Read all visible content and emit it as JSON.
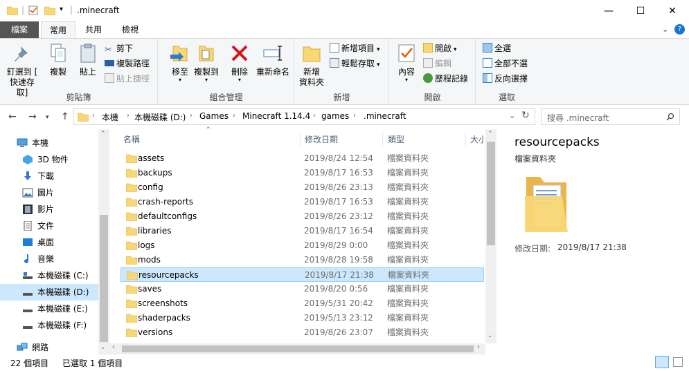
{
  "window": {
    "title": ".minecraft",
    "controls": {
      "minimize": "—",
      "maximize": "☐",
      "close": "✕"
    }
  },
  "ribbon": {
    "tabs": [
      "檔案",
      "常用",
      "共用",
      "檢視"
    ],
    "groups": {
      "clipboard": {
        "label": "剪貼簿",
        "pin": "釘選到 [\n快速存取]",
        "pin_l1": "釘選到 [",
        "pin_l2": "快速存取]",
        "copy": "複製",
        "paste": "貼上",
        "cut": "剪下",
        "copy_path": "複製路徑",
        "paste_shortcut": "貼上捷徑"
      },
      "organize": {
        "label": "組合管理",
        "move_to": "移至",
        "copy_to": "複製到",
        "delete": "刪除",
        "rename": "重新命名"
      },
      "new": {
        "label": "新增",
        "new_folder_l1": "新增",
        "new_folder_l2": "資料夾",
        "new_item": "新增項目",
        "easy_access": "輕鬆存取"
      },
      "open": {
        "label": "開啟",
        "properties": "內容",
        "open": "開啟",
        "edit": "編輯",
        "history": "歷程記錄"
      },
      "select": {
        "label": "選取",
        "select_all": "全選",
        "select_none": "全部不選",
        "invert": "反向選擇"
      }
    }
  },
  "address": {
    "crumbs": [
      "本機",
      "本機磁碟 (D:)",
      "Games",
      "Minecraft 1.14.4",
      "games",
      ".minecraft"
    ],
    "search_placeholder": "搜尋 .minecraft"
  },
  "sidebar": {
    "items": [
      {
        "label": "本機",
        "icon": "computer-icon"
      },
      {
        "label": "3D 物件",
        "icon": "3d-objects-icon"
      },
      {
        "label": "下載",
        "icon": "download-icon"
      },
      {
        "label": "圖片",
        "icon": "pictures-icon"
      },
      {
        "label": "影片",
        "icon": "videos-icon"
      },
      {
        "label": "文件",
        "icon": "documents-icon"
      },
      {
        "label": "桌面",
        "icon": "desktop-icon"
      },
      {
        "label": "音樂",
        "icon": "music-icon"
      },
      {
        "label": "本機磁碟 (C:)",
        "icon": "drive-icon"
      },
      {
        "label": "本機磁碟 (D:)",
        "icon": "drive-icon"
      },
      {
        "label": "本機磁碟 (E:)",
        "icon": "drive-icon"
      },
      {
        "label": "本機磁碟 (F:)",
        "icon": "drive-icon"
      },
      {
        "label": "網路",
        "icon": "network-icon"
      }
    ]
  },
  "filelist": {
    "columns": {
      "name": "名稱",
      "date": "修改日期",
      "type": "類型",
      "size": "大小"
    },
    "rows": [
      {
        "name": "assets",
        "date": "2019/8/24 12:54",
        "type": "檔案資料夾"
      },
      {
        "name": "backups",
        "date": "2019/8/17 16:53",
        "type": "檔案資料夾"
      },
      {
        "name": "config",
        "date": "2019/8/26 23:13",
        "type": "檔案資料夾"
      },
      {
        "name": "crash-reports",
        "date": "2019/8/17 16:53",
        "type": "檔案資料夾"
      },
      {
        "name": "defaultconfigs",
        "date": "2019/8/26 23:12",
        "type": "檔案資料夾"
      },
      {
        "name": "libraries",
        "date": "2019/8/17 16:54",
        "type": "檔案資料夾"
      },
      {
        "name": "logs",
        "date": "2019/8/29 0:00",
        "type": "檔案資料夾"
      },
      {
        "name": "mods",
        "date": "2019/8/28 19:58",
        "type": "檔案資料夾"
      },
      {
        "name": "resourcepacks",
        "date": "2019/8/17 21:38",
        "type": "檔案資料夾"
      },
      {
        "name": "saves",
        "date": "2019/8/20 0:56",
        "type": "檔案資料夾"
      },
      {
        "name": "screenshots",
        "date": "2019/5/31 20:42",
        "type": "檔案資料夾"
      },
      {
        "name": "shaderpacks",
        "date": "2019/5/13 23:12",
        "type": "檔案資料夾"
      },
      {
        "name": "versions",
        "date": "2019/8/26 23:07",
        "type": "檔案資料夾"
      }
    ]
  },
  "preview": {
    "title": "resourcepacks",
    "subtitle": "檔案資料夾",
    "meta_label": "修改日期:",
    "meta_value": "2019/8/17 21:38"
  },
  "status": {
    "count": "22 個項目",
    "selected": "已選取 1 個項目"
  },
  "colors": {
    "accent": "#0078d7",
    "selection": "#cce8ff",
    "folder": "#f8d775"
  }
}
